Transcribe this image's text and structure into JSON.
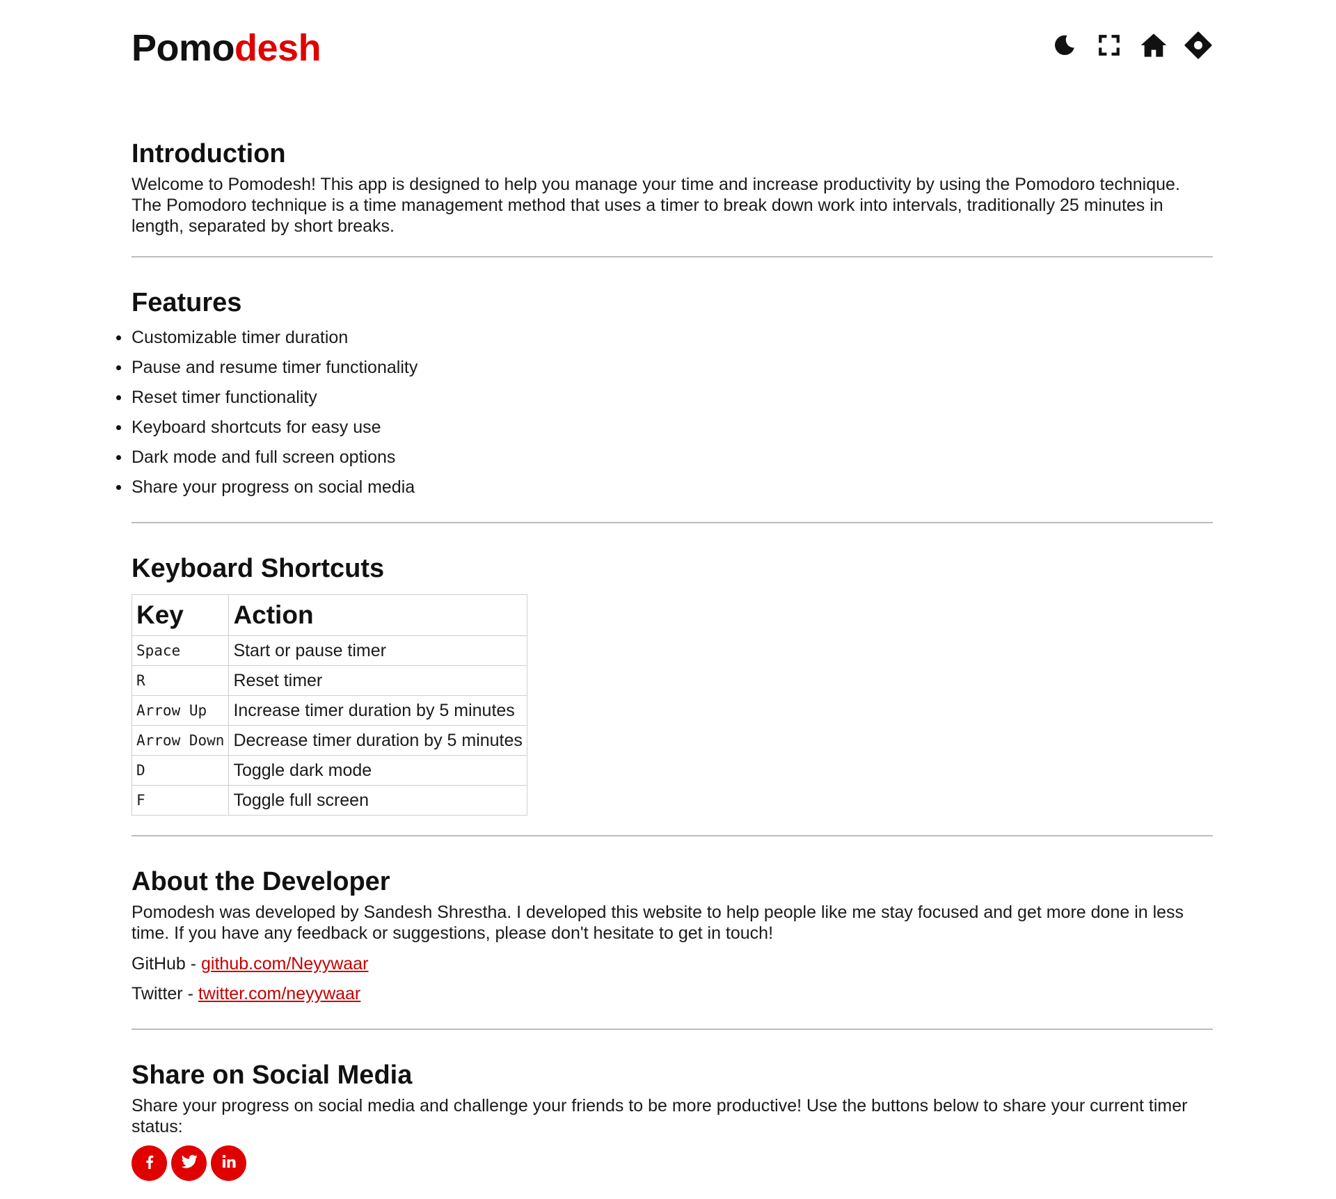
{
  "header": {
    "logo_part1": "Pomo",
    "logo_part2": "desh",
    "brand_color": "#e00000",
    "icons": [
      "moon-icon",
      "fullscreen-icon",
      "home-icon",
      "location-diamond-icon"
    ]
  },
  "intro": {
    "title": "Introduction",
    "text": "Welcome to Pomodesh! This app is designed to help you manage your time and increase productivity by using the Pomodoro technique. The Pomodoro technique is a time management method that uses a timer to break down work into intervals, traditionally 25 minutes in length, separated by short breaks."
  },
  "features": {
    "title": "Features",
    "items": [
      "Customizable timer duration",
      "Pause and resume timer functionality",
      "Reset timer functionality",
      "Keyboard shortcuts for easy use",
      "Dark mode and full screen options",
      "Share your progress on social media"
    ]
  },
  "shortcuts": {
    "title": "Keyboard Shortcuts",
    "headers": [
      "Key",
      "Action"
    ],
    "rows": [
      {
        "key": "Space",
        "action": "Start or pause timer"
      },
      {
        "key": "R",
        "action": "Reset timer"
      },
      {
        "key": "Arrow Up",
        "action": "Increase timer duration by 5 minutes"
      },
      {
        "key": "Arrow Down",
        "action": "Decrease timer duration by 5 minutes"
      },
      {
        "key": "D",
        "action": "Toggle dark mode"
      },
      {
        "key": "F",
        "action": "Toggle full screen"
      }
    ]
  },
  "developer": {
    "title": "About the Developer",
    "text": "Pomodesh was developed by Sandesh Shrestha. I developed this website to help people like me stay focused and get more done in less time. If you have any feedback or suggestions, please don't hesitate to get in touch!",
    "links": [
      {
        "label": "GitHub - ",
        "link_text": "github.com/Neyywaar"
      },
      {
        "label": "Twitter - ",
        "link_text": "twitter.com/neyywaar"
      }
    ],
    "link_color": "#c40000"
  },
  "social": {
    "title": "Share on Social Media",
    "text": "Share your progress on social media and challenge your friends to be more productive! Use the buttons below to share your current timer status:",
    "buttons": [
      "facebook-icon",
      "twitter-icon",
      "linkedin-icon"
    ],
    "button_color": "#e00000"
  }
}
